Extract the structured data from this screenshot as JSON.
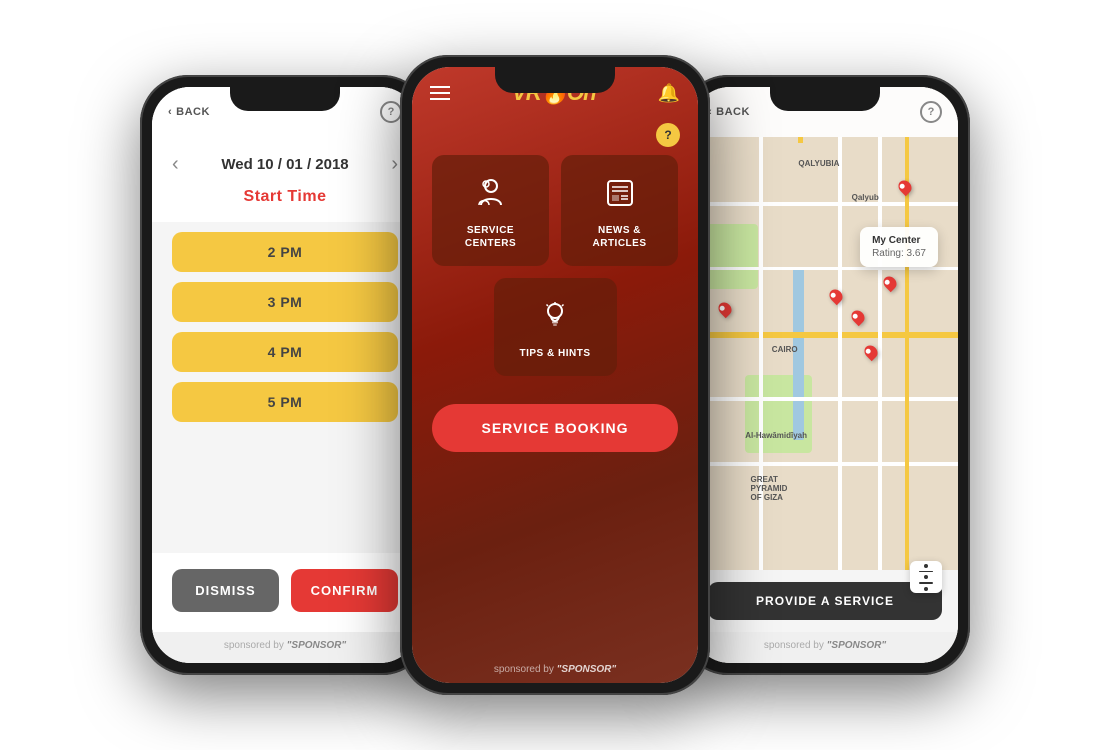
{
  "phones": {
    "left": {
      "header": {
        "back_label": "BACK",
        "help_label": "?"
      },
      "date": "Wed 10 / 01 / 2018",
      "section_label": "Start Time",
      "time_slots": [
        "2 PM",
        "3 PM",
        "4 PM",
        "5 PM"
      ],
      "buttons": {
        "dismiss": "DISMISS",
        "confirm": "CONFIRM"
      },
      "sponsor": "sponsored by",
      "sponsor_name": "\"SPONSOR\""
    },
    "center": {
      "menu_icon": "≡",
      "logo": "VROOn",
      "bell": "🔔",
      "help": "?",
      "menu_items": [
        {
          "id": "service-centers",
          "icon": "👷",
          "label": "SERVICE\nCENTERS"
        },
        {
          "id": "news-articles",
          "icon": "📰",
          "label": "NEWS &\nARTICLES"
        },
        {
          "id": "tips-hints",
          "icon": "💡",
          "label": "TIPS & HINTS"
        }
      ],
      "booking_btn": "SERVICE BOOKING",
      "sponsor": "sponsored by",
      "sponsor_name": "\"SPONSOR\""
    },
    "right": {
      "header": {
        "back_label": "BACK",
        "help_label": "?"
      },
      "map": {
        "popup": {
          "name": "My Center",
          "rating": "Rating: 3.67"
        },
        "regions": [
          "QALYUBIA",
          "Qalyub",
          "CAIRO",
          "Al-Hawāmidīyah",
          "GREAT PYRAMID OF GIZA"
        ]
      },
      "provide_btn": "PROVIDE A SERVICE",
      "sponsor": "sponsored by",
      "sponsor_name": "\"SPONSOR\""
    }
  }
}
